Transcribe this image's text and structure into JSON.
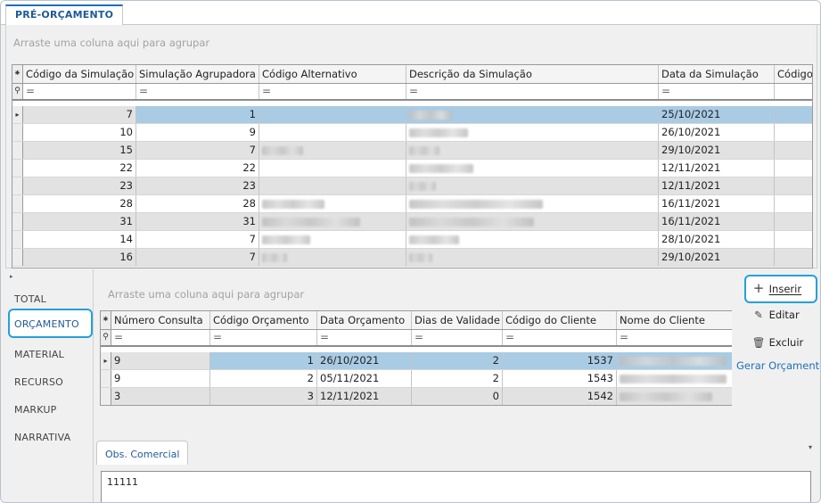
{
  "window": {
    "tab_title": "PRÉ-ORÇAMENTO"
  },
  "top_grid": {
    "group_hint": "Arraste uma coluna aqui para agrupar",
    "columns": [
      "Código da Simulação",
      "Simulação Agrupadora",
      "Código Alternativo",
      "Descrição da Simulação",
      "Data da Simulação",
      "Código"
    ],
    "filter_symbol": "=",
    "rows": [
      {
        "codigo": "7",
        "agrupadora": "1",
        "data": "25/10/2021"
      },
      {
        "codigo": "10",
        "agrupadora": "9",
        "data": "26/10/2021"
      },
      {
        "codigo": "15",
        "agrupadora": "7",
        "data": "29/10/2021"
      },
      {
        "codigo": "22",
        "agrupadora": "22",
        "data": "12/11/2021"
      },
      {
        "codigo": "23",
        "agrupadora": "23",
        "data": "12/11/2021"
      },
      {
        "codigo": "28",
        "agrupadora": "28",
        "data": "16/11/2021"
      },
      {
        "codigo": "31",
        "agrupadora": "31",
        "data": "16/11/2021"
      },
      {
        "codigo": "14",
        "agrupadora": "7",
        "data": "28/10/2021"
      },
      {
        "codigo": "16",
        "agrupadora": "7",
        "data": "29/10/2021"
      }
    ]
  },
  "sidebar": {
    "items": [
      "TOTAL",
      "ORÇAMENTO",
      "MATERIAL",
      "RECURSO",
      "MARKUP",
      "NARRATIVA"
    ],
    "active": "ORÇAMENTO"
  },
  "bottom_grid": {
    "group_hint": "Arraste uma coluna aqui para agrupar",
    "columns": [
      "Número Consulta",
      "Código Orçamento",
      "Data Orçamento",
      "Dias de Validade",
      "Código  do Cliente",
      "Nome do Cliente"
    ],
    "filter_symbol": "=",
    "rows": [
      {
        "consulta": "9",
        "orcamento": "1",
        "data": "26/10/2021",
        "validade": "2",
        "cliente": "1537"
      },
      {
        "consulta": "9",
        "orcamento": "2",
        "data": "05/11/2021",
        "validade": "2",
        "cliente": "1543"
      },
      {
        "consulta": "3",
        "orcamento": "3",
        "data": "12/11/2021",
        "validade": "0",
        "cliente": "1542"
      }
    ]
  },
  "actions": {
    "insert_label": "Inserir",
    "edit_label": "Editar",
    "delete_label": "Excluir",
    "generate_label": "Gerar Orçamento"
  },
  "obs": {
    "tab_label": "Obs. Comercial",
    "value": "11111"
  },
  "icons": {
    "insert": "plus-icon",
    "edit": "edit-document-icon",
    "delete": "trash-icon"
  },
  "colors": {
    "accent": "#1e6fb8",
    "highlight_border": "#25a0d8",
    "selected_cell": "#a9cbe4",
    "alt_row": "#e2e2e2"
  }
}
